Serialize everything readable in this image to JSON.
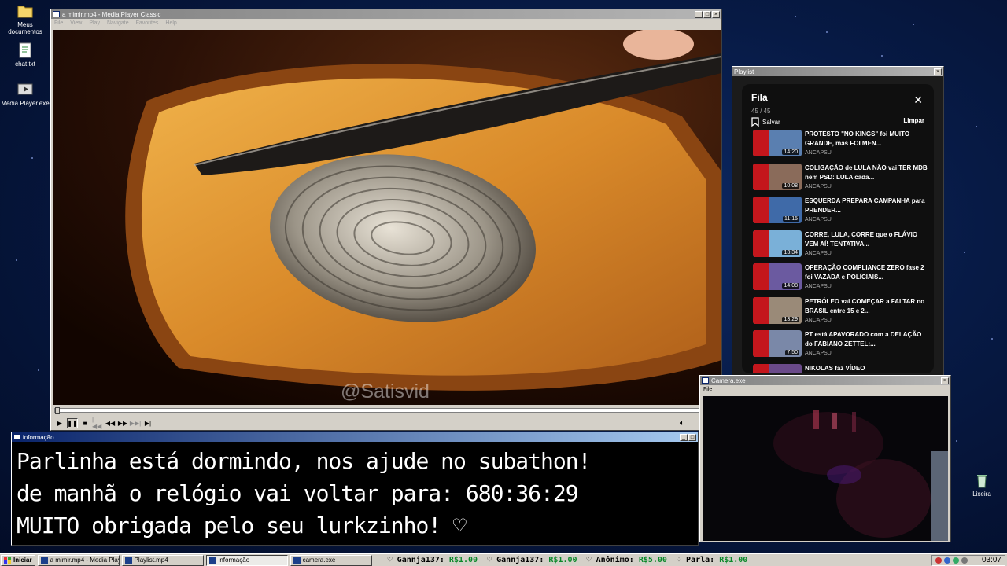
{
  "desktop": {
    "icons": [
      {
        "label": "Meus documentos",
        "icon": "folder-icon"
      },
      {
        "label": "chat.txt",
        "icon": "text-file-icon"
      },
      {
        "label": "Media Player.exe",
        "icon": "media-player-icon"
      },
      {
        "label": "Lixeira",
        "icon": "recycle-bin-icon"
      }
    ]
  },
  "player": {
    "title": "a mimir.mp4 - Media Player Classic",
    "menu": [
      "File",
      "View",
      "Play",
      "Navigate",
      "Favorites",
      "Help"
    ],
    "watermark": "@Satisvid",
    "progress": 0.0
  },
  "playlist": {
    "window_title": "Playlist",
    "heading": "Fila",
    "count": "45 / 45",
    "save_label": "Salvar",
    "clear_label": "Limpar",
    "items": [
      {
        "title": "PROTESTO \"NO KINGS\" foi MUITO GRANDE, mas FOI MEN...",
        "channel": "ANCAPSU",
        "duration": "14:20"
      },
      {
        "title": "COLIGAÇÃO de LULA NÃO vai TER MDB nem PSD: LULA cada...",
        "channel": "ANCAPSU",
        "duration": "10:08"
      },
      {
        "title": "ESQUERDA PREPARA CAMPANHA para PRENDER...",
        "channel": "ANCAPSU",
        "duration": "11:15"
      },
      {
        "title": "CORRE, LULA, CORRE que o FLÁVIO VEM AÍ! TENTATIVA...",
        "channel": "ANCAPSU",
        "duration": "13:34"
      },
      {
        "title": "OPERAÇÃO COMPLIANCE ZERO fase 2 foi VAZADA e POLÍCIAIS...",
        "channel": "ANCAPSU",
        "duration": "14:08"
      },
      {
        "title": "PETRÓLEO vai COMEÇAR a FALTAR no BRASIL entre 15 e 2...",
        "channel": "ANCAPSU",
        "duration": "13:29"
      },
      {
        "title": "PT está APAVORADO com a DELAÇÃO do FABIANO ZETTEL:...",
        "channel": "ANCAPSU",
        "duration": "7:50"
      },
      {
        "title": "NIKOLAS faz VÍDEO",
        "channel": "",
        "duration": ""
      }
    ]
  },
  "info": {
    "title": "informação",
    "lines": [
      "Parlinha está dormindo, nos ajude no subathon!",
      "de manhã o relógio vai voltar para:  680:36:29",
      "MUITO obrigada pelo seu lurkzinho! ♡"
    ]
  },
  "camera": {
    "title": "Camera.exe",
    "menu_file": "File"
  },
  "taskbar": {
    "start_label": "Iniciar",
    "tasks": [
      "a mimir.mp4 - Media Playe...",
      "Playlist.mp4",
      "informação",
      "camera.exe"
    ],
    "ticker": [
      {
        "name": "Gannja137:",
        "amount": "R$1.00"
      },
      {
        "name": "Gannja137:",
        "amount": "R$1.00"
      },
      {
        "name": "Anônimo:",
        "amount": "R$5.00"
      },
      {
        "name": "Parla:",
        "amount": "R$1.00"
      }
    ],
    "clock": "03:07"
  },
  "colors": {
    "titlebar_active": "#0a246a",
    "window_face": "#d4d0c8",
    "donation_amount": "#0a8a2a",
    "flag_red": "#c4161c"
  }
}
